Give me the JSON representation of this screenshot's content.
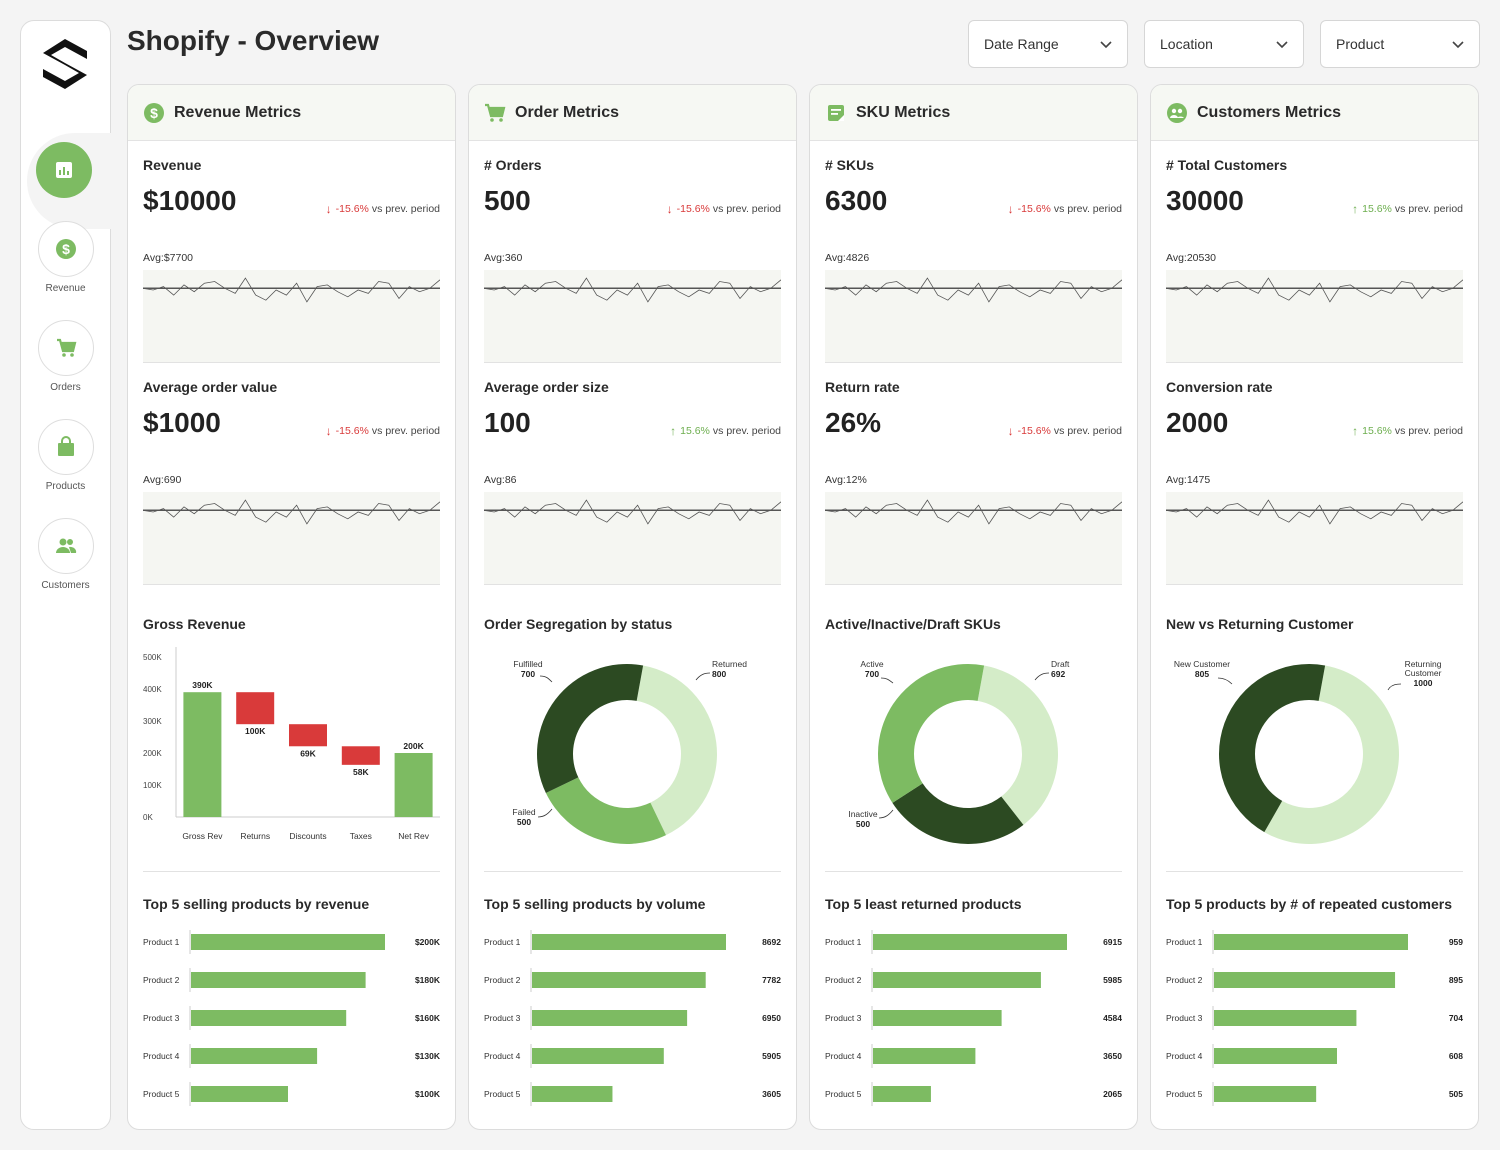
{
  "page": {
    "title": "Shopify - Overview"
  },
  "filters": [
    {
      "label": "Date Range",
      "icon": "chevron-down-icon"
    },
    {
      "label": "Location",
      "icon": "chevron-down-icon"
    },
    {
      "label": "Product",
      "icon": "chevron-down-icon"
    }
  ],
  "sidebar": {
    "logo": "shopify-s-logo",
    "items": [
      {
        "label": "",
        "icon": "bar-chart-icon",
        "active": true
      },
      {
        "label": "Revenue",
        "icon": "dollar-icon"
      },
      {
        "label": "Orders",
        "icon": "cart-icon"
      },
      {
        "label": "Products",
        "icon": "shopping-bag-icon"
      },
      {
        "label": "Customers",
        "icon": "users-icon"
      }
    ]
  },
  "colors": {
    "accent": "#7dbb62",
    "dark_green": "#2c4a22",
    "light_green": "#d4ecc8",
    "negative": "#d93a3a",
    "positive": "#6dae4f"
  },
  "panels": [
    {
      "title": "Revenue Metrics",
      "icon": "dollar-icon",
      "metrics": [
        {
          "label": "Revenue",
          "value": "$10000",
          "change": "-15.6%",
          "direction": "down",
          "suffix": "vs prev. period",
          "avg": "Avg:$7700"
        },
        {
          "label": "Average order value",
          "value": "$1000",
          "change": "-15.6%",
          "direction": "down",
          "suffix": "vs prev. period",
          "avg": "Avg:690"
        }
      ],
      "chart": {
        "title": "Gross Revenue",
        "type": "waterfall"
      },
      "bars": {
        "title": "Top 5 selling products by revenue"
      }
    },
    {
      "title": "Order Metrics",
      "icon": "cart-icon",
      "metrics": [
        {
          "label": "# Orders",
          "value": "500",
          "change": "-15.6%",
          "direction": "down",
          "suffix": "vs prev. period",
          "avg": "Avg:360"
        },
        {
          "label": "Average order size",
          "value": "100",
          "change": "15.6%",
          "direction": "up",
          "suffix": "vs prev. period",
          "avg": "Avg:86"
        }
      ],
      "chart": {
        "title": "Order Segregation by status",
        "type": "donut"
      },
      "bars": {
        "title": "Top 5 selling products by volume"
      }
    },
    {
      "title": "SKU Metrics",
      "icon": "list-icon",
      "metrics": [
        {
          "label": "# SKUs",
          "value": "6300",
          "change": "-15.6%",
          "direction": "down",
          "suffix": "vs prev. period",
          "avg": "Avg:4826"
        },
        {
          "label": "Return rate",
          "value": "26%",
          "change": "-15.6%",
          "direction": "down",
          "suffix": "vs prev. period",
          "avg": "Avg:12%"
        }
      ],
      "chart": {
        "title": "Active/Inactive/Draft SKUs",
        "type": "donut"
      },
      "bars": {
        "title": "Top 5 least returned products"
      }
    },
    {
      "title": "Customers Metrics",
      "icon": "customers-icon",
      "metrics": [
        {
          "label": "# Total Customers",
          "value": "30000",
          "change": "15.6%",
          "direction": "up",
          "suffix": "vs prev. period",
          "avg": "Avg:20530"
        },
        {
          "label": "Conversion rate",
          "value": "2000",
          "change": "15.6%",
          "direction": "up",
          "suffix": "vs prev. period",
          "avg": "Avg:1475"
        }
      ],
      "chart": {
        "title": "New vs Returning Customer",
        "type": "donut"
      },
      "bars": {
        "title": "Top 5 products by # of repeated customers"
      }
    }
  ],
  "chart_data": [
    {
      "type": "line",
      "title": "",
      "x": [
        1,
        2,
        3,
        4,
        5,
        6,
        7,
        8,
        9,
        10,
        11,
        12,
        13,
        14,
        15,
        16,
        17,
        18,
        19,
        20,
        21,
        22,
        23,
        24,
        25,
        26,
        27,
        28,
        29,
        30
      ],
      "y": [
        0.55,
        0.5,
        0.6,
        0.35,
        0.65,
        0.45,
        0.7,
        0.75,
        0.55,
        0.4,
        0.85,
        0.35,
        0.2,
        0.5,
        0.35,
        0.7,
        0.15,
        0.6,
        0.65,
        0.45,
        0.3,
        0.5,
        0.4,
        0.75,
        0.7,
        0.25,
        0.6,
        0.45,
        0.55,
        0.8
      ],
      "avg_line": 0.55
    },
    {
      "type": "bar",
      "subtype": "waterfall",
      "title": "Gross Revenue",
      "categories": [
        "Gross Rev",
        "Returns",
        "Discounts",
        "Taxes",
        "Net Rev"
      ],
      "values": [
        390,
        -100,
        -69,
        -58,
        200
      ],
      "labels": [
        "390K",
        "100K",
        "69K",
        "58K",
        "200K"
      ],
      "yticks": [
        "0K",
        "100K",
        "200K",
        "300K",
        "400K",
        "500K"
      ],
      "ylim": [
        0,
        500
      ]
    },
    {
      "type": "pie",
      "title": "Order Segregation by status",
      "slices": [
        {
          "name": "Returned",
          "value": 800
        },
        {
          "name": "Failed",
          "value": 500
        },
        {
          "name": "Fulfilled",
          "value": 700
        }
      ]
    },
    {
      "type": "pie",
      "title": "Active/Inactive/Draft SKUs",
      "slices": [
        {
          "name": "Draft",
          "value": 692
        },
        {
          "name": "Inactive",
          "value": 500
        },
        {
          "name": "Active",
          "value": 700
        }
      ]
    },
    {
      "type": "pie",
      "title": "New vs Returning Customer",
      "slices": [
        {
          "name": "Returning Customer",
          "value": 1000
        },
        {
          "name": "New Customer",
          "value": 805
        }
      ]
    },
    {
      "type": "bar",
      "title": "Top 5 selling products by revenue",
      "categories": [
        "Product 1",
        "Product 2",
        "Product 3",
        "Product 4",
        "Product 5"
      ],
      "values": [
        200,
        180,
        160,
        130,
        100
      ],
      "labels": [
        "$200K",
        "$180K",
        "$160K",
        "$130K",
        "$100K"
      ]
    },
    {
      "type": "bar",
      "title": "Top 5 selling products by volume",
      "categories": [
        "Product 1",
        "Product 2",
        "Product 3",
        "Product 4",
        "Product 5"
      ],
      "values": [
        8692,
        7782,
        6950,
        5905,
        3605
      ],
      "labels": [
        "8692",
        "7782",
        "6950",
        "5905",
        "3605"
      ]
    },
    {
      "type": "bar",
      "title": "Top 5 least returned products",
      "categories": [
        "Product 1",
        "Product 2",
        "Product 3",
        "Product 4",
        "Product 5"
      ],
      "values": [
        6915,
        5985,
        4584,
        3650,
        2065
      ],
      "labels": [
        "6915",
        "5985",
        "4584",
        "3650",
        "2065"
      ]
    },
    {
      "type": "bar",
      "title": "Top 5 products by # of repeated customers",
      "categories": [
        "Product 1",
        "Product 2",
        "Product 3",
        "Product 4",
        "Product 5"
      ],
      "values": [
        959,
        895,
        704,
        608,
        505
      ],
      "labels": [
        "959",
        "895",
        "704",
        "608",
        "505"
      ]
    }
  ]
}
